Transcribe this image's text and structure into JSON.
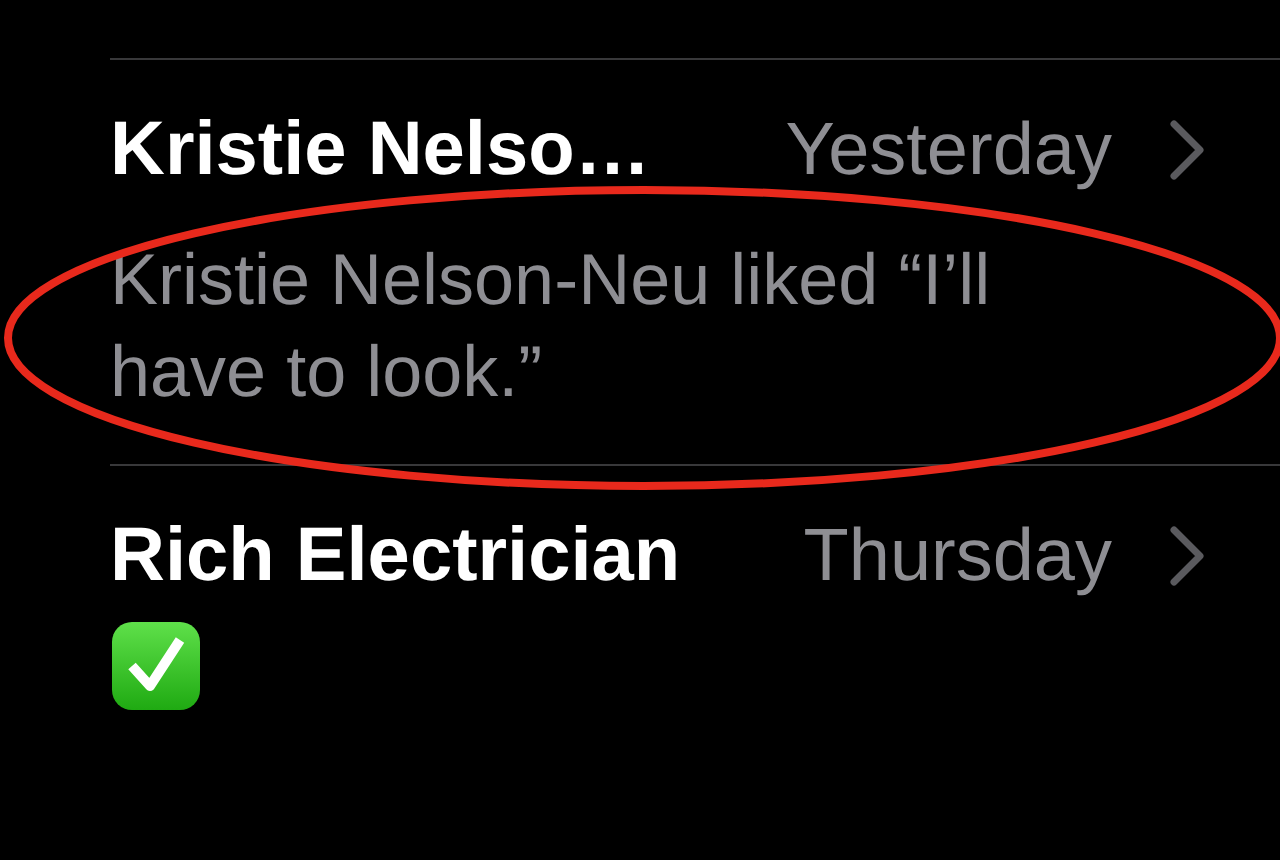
{
  "conversations": [
    {
      "name": "Kristie Nelso…",
      "date": "Yesterday",
      "preview": "Kristie Nelson-Neu liked “I’ll have to look.”",
      "kind": "text"
    },
    {
      "name": "Rich Electrician",
      "date": "Thursday",
      "kind": "checkmark-emoji"
    }
  ],
  "annotation": {
    "kind": "ellipse",
    "color": "#e8291c"
  }
}
